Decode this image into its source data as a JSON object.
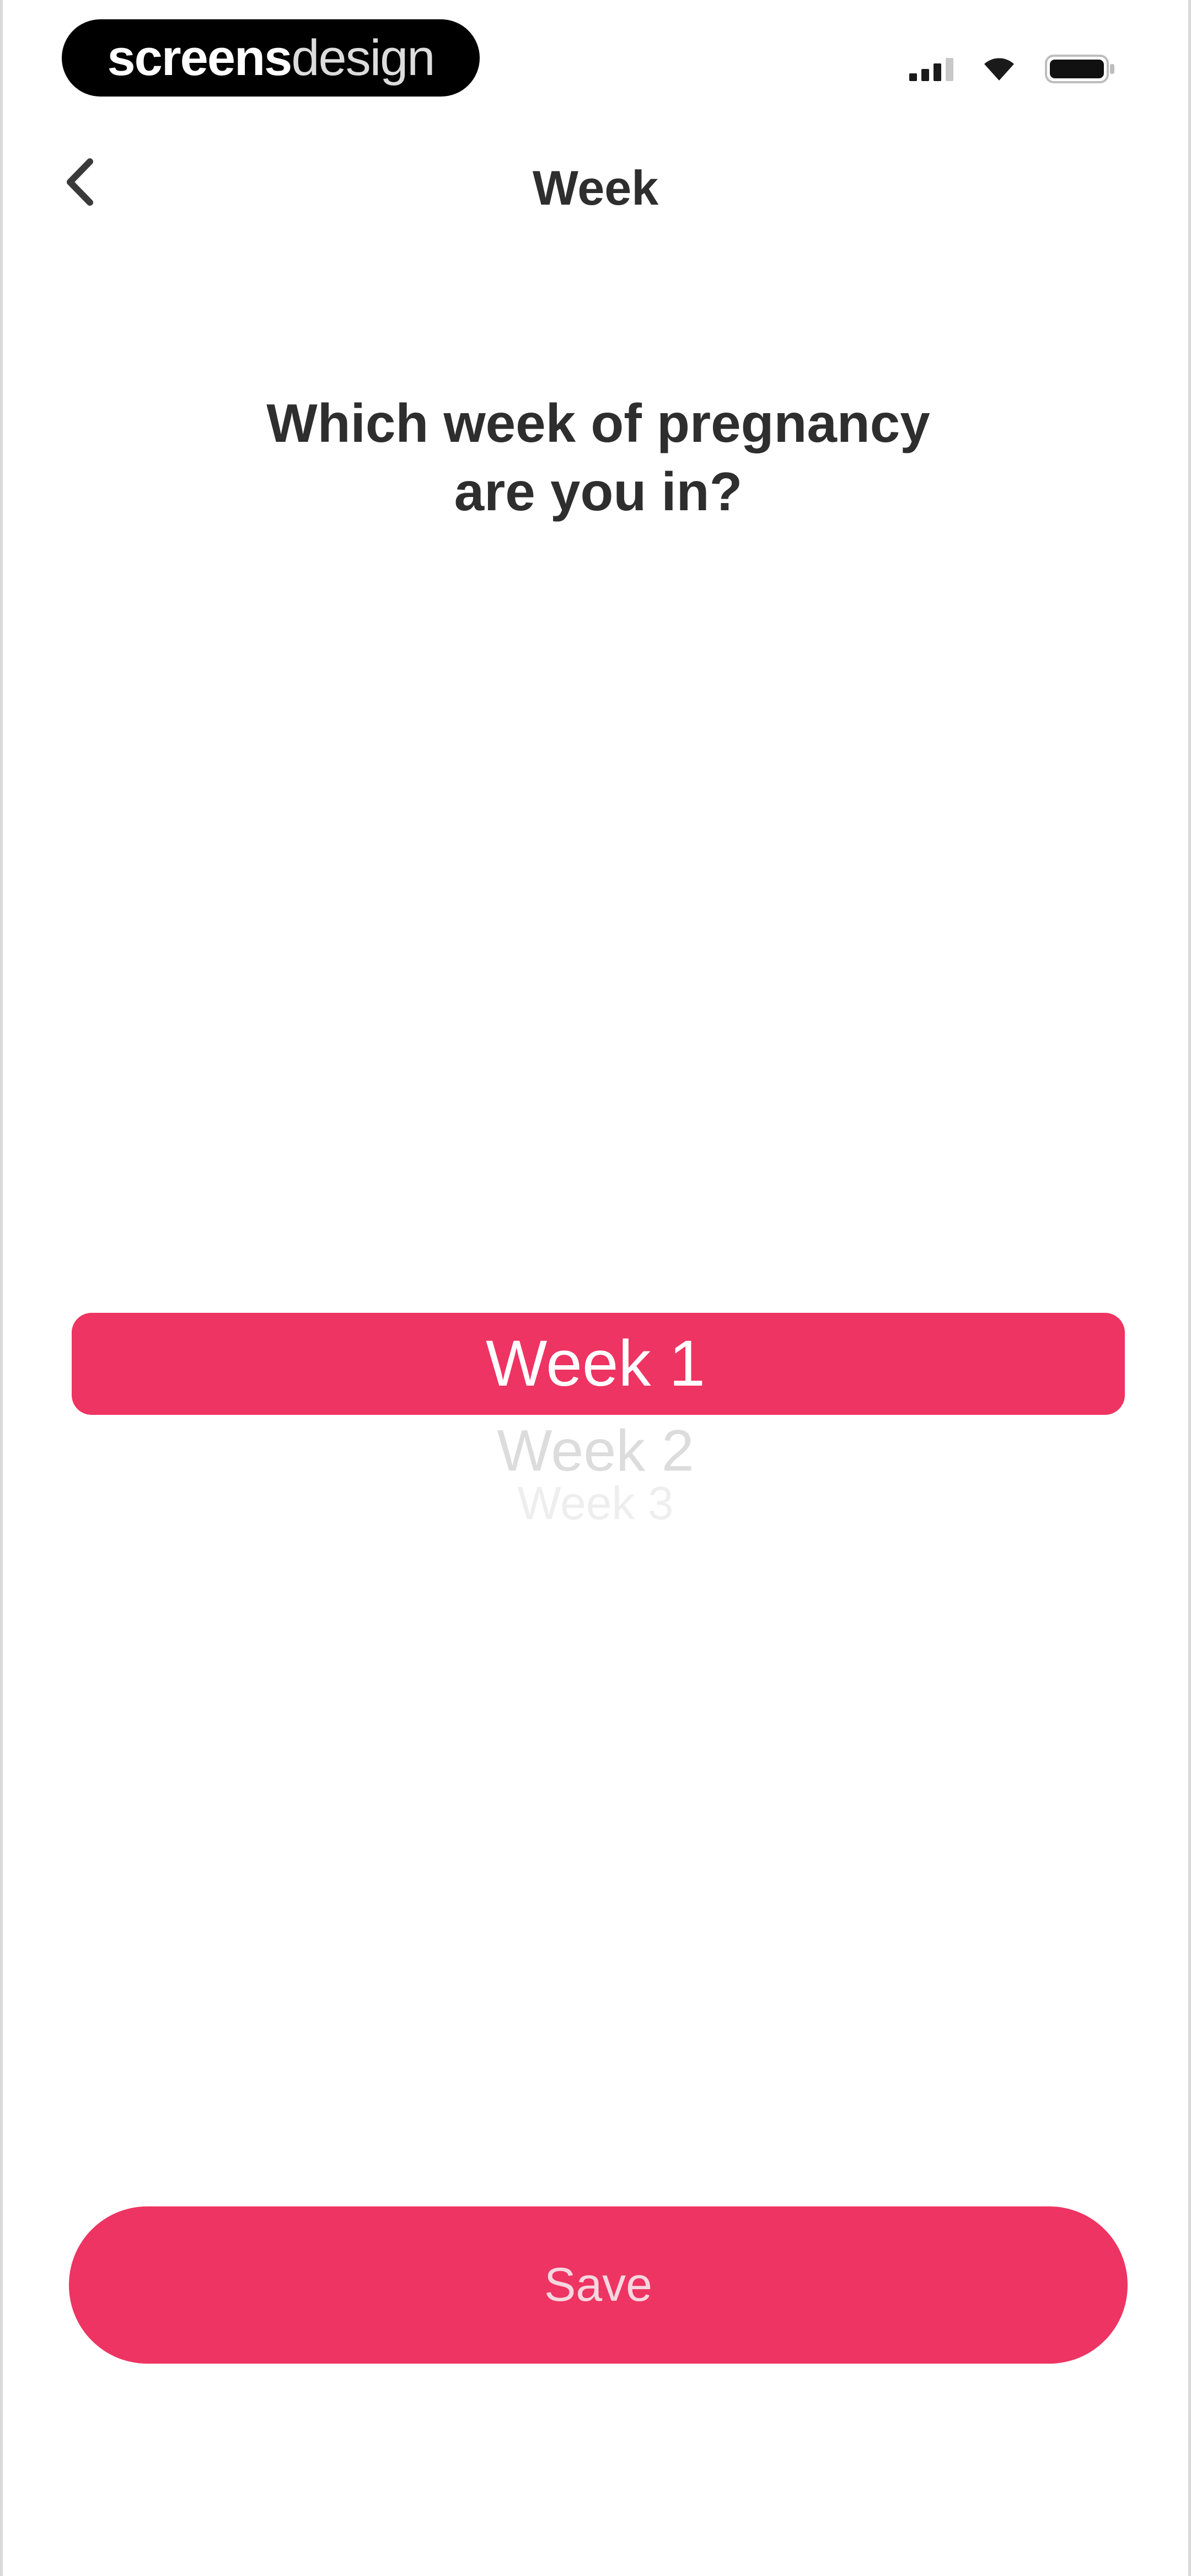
{
  "status_bar": {
    "brand_bold": "screens",
    "brand_light": "design",
    "signal_icon": "cellular-signal-icon",
    "wifi_icon": "wifi-icon",
    "battery_icon": "battery-icon"
  },
  "nav": {
    "back_icon": "chevron-left-icon",
    "title": "Week"
  },
  "question": {
    "line1": "Which week of pregnancy",
    "line2": "are you in?"
  },
  "picker": {
    "options": [
      "Week 1",
      "Week 2",
      "Week 3"
    ],
    "selected": "Week 1"
  },
  "actions": {
    "save_label": "Save"
  },
  "colors": {
    "accent": "#ee3462",
    "background": "#ffffff",
    "text": "#2e2e2e"
  }
}
